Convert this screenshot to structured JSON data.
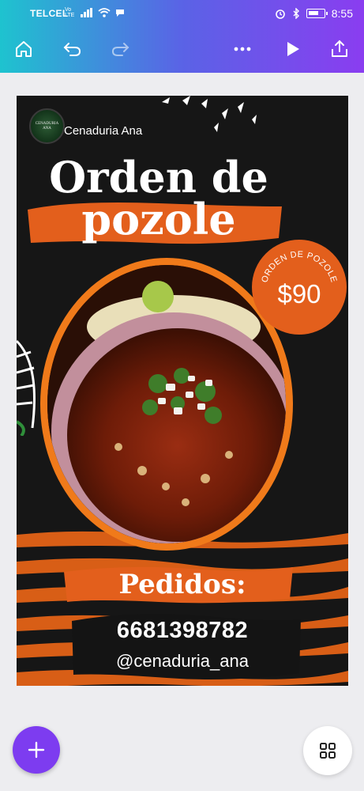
{
  "status_bar": {
    "carrier": "TELCEL",
    "network": "Vo LTE",
    "time": "8:55",
    "battery_level": 0.7
  },
  "toolbar": {
    "home_icon": "home-icon",
    "undo_icon": "undo-icon",
    "redo_icon": "redo-icon",
    "more_icon": "more-icon",
    "play_icon": "play-icon",
    "share_icon": "share-icon"
  },
  "design": {
    "logo_title": "CENADURIA ANA",
    "brand_name": "Cenaduria Ana",
    "headline_line1": "Orden de",
    "headline_line2": "pozole",
    "badge_label": "ORDEN DE POZOLE",
    "price": "$90",
    "orders_label": "Pedidos:",
    "phone": "6681398782",
    "handle": "@cenaduria_ana"
  },
  "colors": {
    "accent_orange": "#e35f1c",
    "frame_orange": "#f07a1a",
    "canvas_bg": "#161616",
    "fab_purple": "#7d3cf0"
  }
}
